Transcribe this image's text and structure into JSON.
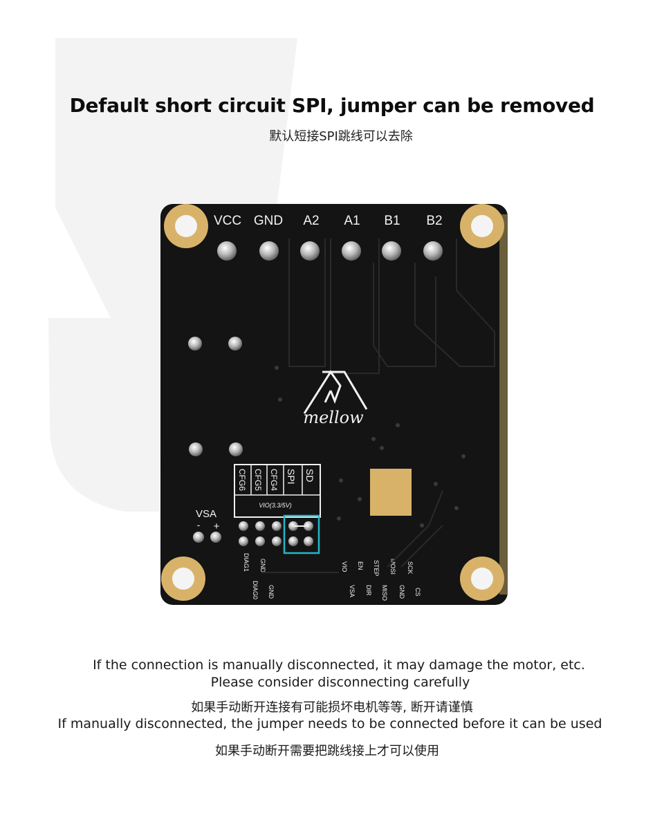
{
  "heading": {
    "title": "Default short circuit SPI, jumper can be removed",
    "subtitle_cn": "默认短接SPI跳线可以去除"
  },
  "board": {
    "terminal_labels": [
      "VCC",
      "GND",
      "A2",
      "A1",
      "B1",
      "B2"
    ],
    "logo_text": "mellow",
    "jumper_labels": [
      "CFG6",
      "CFG5",
      "CFG4",
      "SPI",
      "SD"
    ],
    "vio_label": "VIO(3.3/5V)",
    "vsa_label": "VSA",
    "vsa_minus": "-",
    "vsa_plus": "+",
    "pin_labels_top": [
      "DIAG1",
      "GND",
      "VIO",
      "EN",
      "STEP",
      "MOSI",
      "SCK"
    ],
    "pin_labels_bottom": [
      "DIAG0",
      "GND",
      "VSA",
      "DIR",
      "MISO",
      "GND",
      "CS"
    ],
    "colors": {
      "pcb": "#141414",
      "gold": "#d9b26a",
      "highlight": "#22b8c8",
      "silkscreen": "#f2f2f2"
    }
  },
  "notes": {
    "line1": "If the connection is manually disconnected, it may damage the motor, etc.",
    "line2": "Please consider disconnecting carefully",
    "line3_cn": "如果手动断开连接有可能损坏电机等等, 断开请谨慎",
    "line4": "If manually disconnected, the jumper needs to be connected before it can be used",
    "line5_cn": "如果手动断开需要把跳线接上才可以使用"
  }
}
